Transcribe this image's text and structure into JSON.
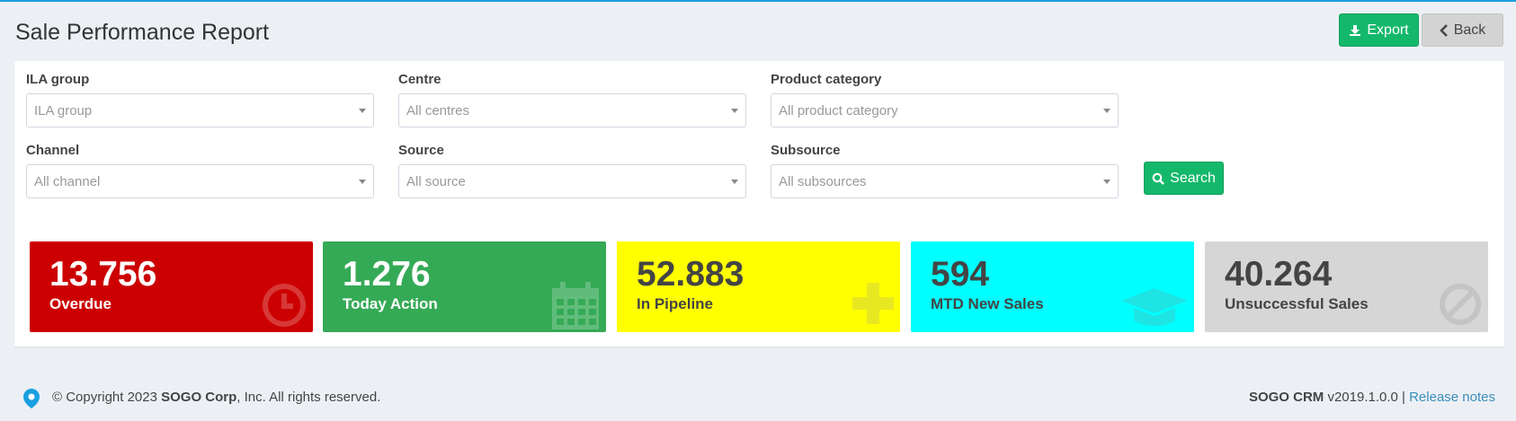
{
  "page": {
    "title": "Sale Performance Report"
  },
  "toolbar": {
    "export_label": "Export",
    "back_label": "Back"
  },
  "filters": {
    "ila_group": {
      "label": "ILA group",
      "placeholder": "ILA group"
    },
    "centre": {
      "label": "Centre",
      "placeholder": "All centres"
    },
    "product_category": {
      "label": "Product category",
      "placeholder": "All product category"
    },
    "channel": {
      "label": "Channel",
      "placeholder": "All channel"
    },
    "source": {
      "label": "Source",
      "placeholder": "All source"
    },
    "subsource": {
      "label": "Subsource",
      "placeholder": "All subsources"
    },
    "search_label": "Search"
  },
  "tiles": [
    {
      "value": "13.756",
      "label": "Overdue",
      "color": "#cc0000",
      "icon": "clock-icon"
    },
    {
      "value": "1.276",
      "label": "Today Action",
      "color": "#35aa56",
      "icon": "calendar-icon"
    },
    {
      "value": "52.883",
      "label": "In Pipeline",
      "color": "#ffff00",
      "icon": "plus-icon"
    },
    {
      "value": "594",
      "label": "MTD New Sales",
      "color": "#00ffff",
      "icon": "graduation-cap-icon"
    },
    {
      "value": "40.264",
      "label": "Unsuccessful Sales",
      "color": "#d6d6d6",
      "icon": "ban-icon"
    }
  ],
  "footer": {
    "copyright_prefix": "© Copyright 2023 ",
    "company": "SOGO Corp",
    "copyright_suffix": ", Inc. All rights reserved.",
    "product": "SOGO CRM",
    "version": " v2019.1.0.0 | ",
    "release_notes": "Release notes"
  },
  "colors": {
    "accent": "#14b86b",
    "topbar": "#1aa0e0",
    "link": "#3c8dbc"
  }
}
